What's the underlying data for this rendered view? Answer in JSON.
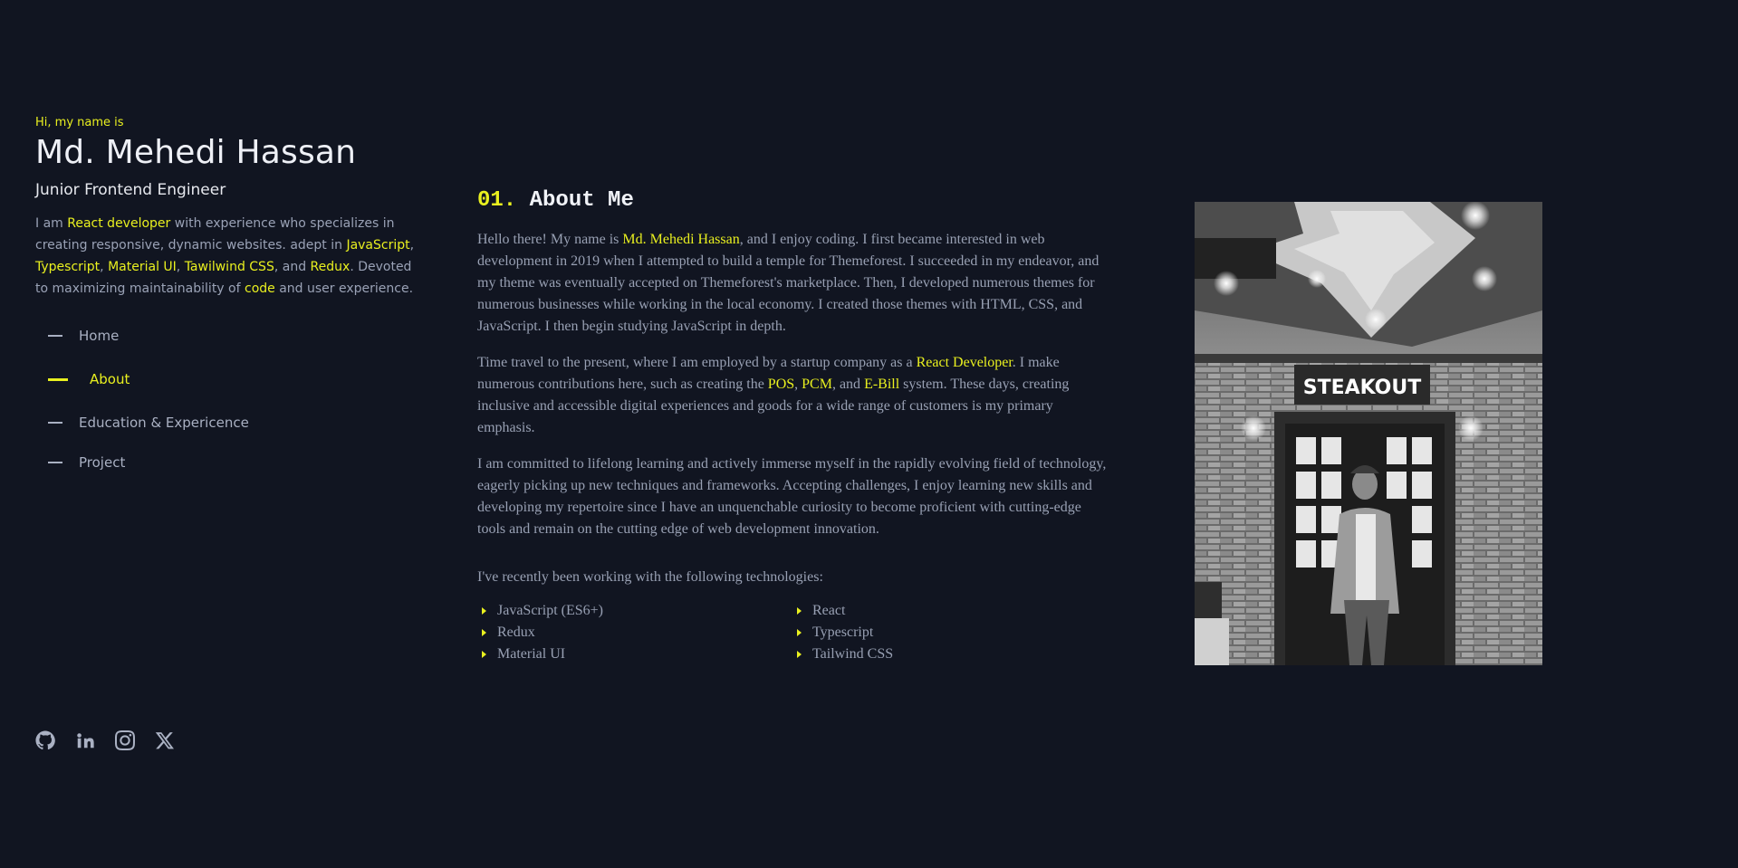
{
  "profile": {
    "greeting": "Hi, my name is",
    "name": "Md. Mehedi Hassan",
    "role": "Junior Frontend Engineer",
    "intro": {
      "t1": "I am ",
      "h1": "React developer",
      "t2": " with experience who specializes in creating responsive, dynamic websites. adept in ",
      "h2": "JavaScript",
      "t3": ", ",
      "h3": "Typescript",
      "t4": ", ",
      "h4": "Material UI",
      "t5": ", ",
      "h5": "Tawilwind CSS",
      "t6": ", and ",
      "h6": "Redux",
      "t7": ". Devoted to maximizing maintainability of ",
      "h7": "code",
      "t8": " and user experience."
    }
  },
  "nav": {
    "items": [
      {
        "label": "Home"
      },
      {
        "label": "About"
      },
      {
        "label": "Education & Expericence"
      },
      {
        "label": "Project"
      }
    ],
    "active_index": 1
  },
  "socials": [
    "github-icon",
    "linkedin-icon",
    "instagram-icon",
    "x-icon"
  ],
  "about": {
    "number": "01.",
    "title": "About Me",
    "p1": {
      "t1": "Hello there! My name is ",
      "h1": "Md. Mehedi Hassan",
      "t2": ", and I enjoy coding. I first became interested in web development in 2019 when I attempted to build a temple for Themeforest. I succeeded in my endeavor, and my theme was eventually accepted on Themeforest's marketplace. Then, I developed numerous themes for numerous businesses while working in the local economy. I created those themes with HTML, CSS, and JavaScript. I then begin studying JavaScript in depth."
    },
    "p2": {
      "t1": "Time travel to the present, where I am employed by a startup company as a ",
      "h1": "React Developer",
      "t2": ". I make numerous contributions here, such as creating the ",
      "h2": "POS",
      "t3": ", ",
      "h3": "PCM",
      "t4": ", and ",
      "h4": "E-Bill",
      "t5": " system. These days, creating inclusive and accessible digital experiences and goods for a wide range of customers is my primary emphasis."
    },
    "p3": "I am committed to lifelong learning and actively immerse myself in the rapidly evolving field of technology, eagerly picking up new techniques and frameworks. Accepting challenges, I enjoy learning new skills and developing my repertoire since I have an unquenchable curiosity to become proficient with cutting-edge tools and remain on the cutting edge of web development innovation.",
    "tech_intro": "I've recently been working with the following technologies:",
    "technologies": [
      "JavaScript (ES6+)",
      "React",
      "Redux",
      "Typescript",
      "Material UI",
      "Tailwind CSS"
    ]
  },
  "photo": {
    "sign_text": "STEAKOUT"
  },
  "colors": {
    "background": "#111521",
    "accent": "#e9f01f",
    "text": "#98a0b3",
    "heading": "#eef0f6"
  }
}
